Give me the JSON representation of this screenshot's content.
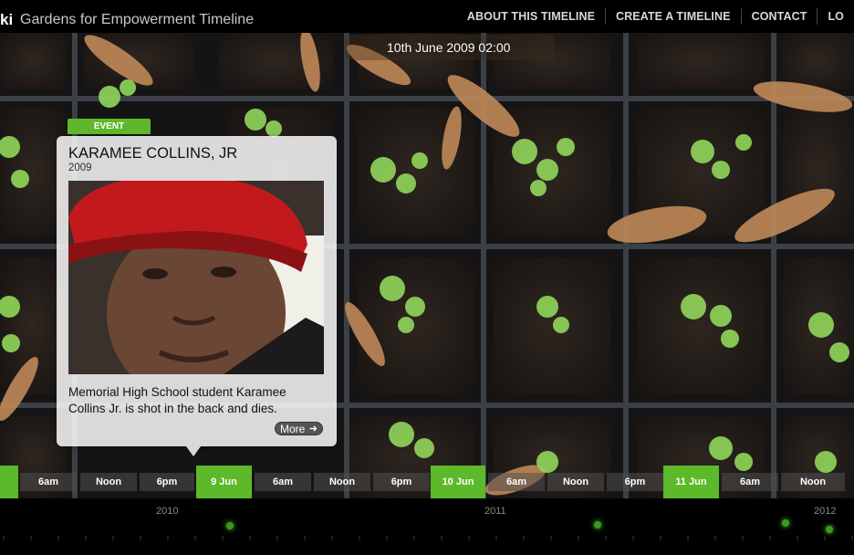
{
  "header": {
    "brand_fragment": "ki",
    "title": "Gardens for Empowerment Timeline",
    "nav": [
      "ABOUT THIS TIMELINE",
      "CREATE A TIMELINE",
      "CONTACT",
      "LO"
    ]
  },
  "current_date": "10th June 2009 02:00",
  "event": {
    "tab_label": "EVENT",
    "title": "KARAMEE COLLINS, JR",
    "year": "2009",
    "description": "Memorial High School student Karamee Collins Jr. is shot in the back and dies.",
    "more_label": "More",
    "more_icon": "arrow-right-icon"
  },
  "timeline_ticks": [
    "6am",
    "Noon",
    "6pm",
    "9 Jun",
    "6am",
    "Noon",
    "6pm",
    "10 Jun",
    "6am",
    "Noon",
    "6pm",
    "11 Jun",
    "6am",
    "Noon"
  ],
  "year_labels": [
    "2010",
    "2011",
    "2012"
  ],
  "colors": {
    "accent_green": "#5cb92a",
    "background": "#000000",
    "nav_text": "#d8d8d8"
  }
}
